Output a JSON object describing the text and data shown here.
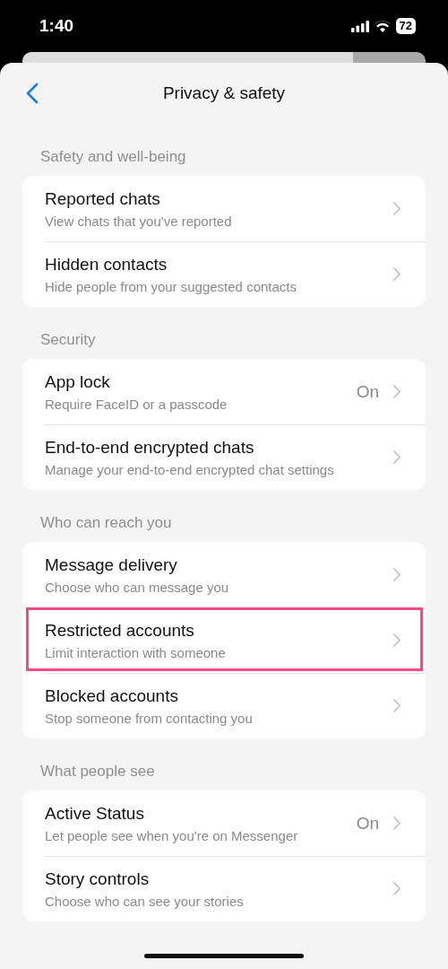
{
  "status_bar": {
    "time": "1:40",
    "battery": "72"
  },
  "header": {
    "title": "Privacy & safety"
  },
  "sections": [
    {
      "title": "Safety and well-being",
      "rows": [
        {
          "title": "Reported chats",
          "subtitle": "View chats that you've reported",
          "highlighted": false
        },
        {
          "title": "Hidden contacts",
          "subtitle": "Hide people from your suggested contacts",
          "highlighted": false
        }
      ]
    },
    {
      "title": "Security",
      "rows": [
        {
          "title": "App lock",
          "subtitle": "Require FaceID or a passcode",
          "value": "On",
          "highlighted": false
        },
        {
          "title": "End-to-end encrypted chats",
          "subtitle": "Manage your end-to-end encrypted chat settings",
          "highlighted": false
        }
      ]
    },
    {
      "title": "Who can reach you",
      "rows": [
        {
          "title": "Message delivery",
          "subtitle": "Choose who can message you",
          "highlighted": false
        },
        {
          "title": "Restricted accounts",
          "subtitle": "Limit interaction with someone",
          "highlighted": true
        },
        {
          "title": "Blocked accounts",
          "subtitle": "Stop someone from contacting you",
          "highlighted": false
        }
      ]
    },
    {
      "title": "What people see",
      "rows": [
        {
          "title": "Active Status",
          "subtitle": "Let people see when you're on Messenger",
          "value": "On",
          "highlighted": false
        },
        {
          "title": "Story controls",
          "subtitle": "Choose who can see your stories",
          "highlighted": false
        }
      ]
    }
  ]
}
